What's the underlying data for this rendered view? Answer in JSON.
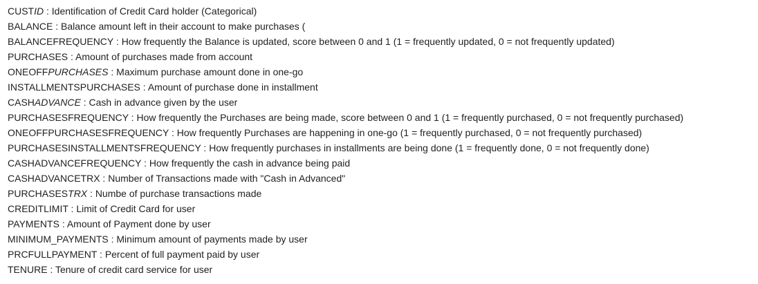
{
  "items": [
    {
      "term_plain": "CUST",
      "term_italic": "ID",
      "sep": " : ",
      "desc": "Identification of Credit Card holder (Categorical)"
    },
    {
      "term_plain": "BALANCE",
      "term_italic": "",
      "sep": " : ",
      "desc": "Balance amount left in their account to make purchases ("
    },
    {
      "term_plain": "BALANCEFREQUENCY",
      "term_italic": "",
      "sep": " : ",
      "desc": "How frequently the Balance is updated, score between 0 and 1 (1 = frequently updated, 0 = not frequently updated)"
    },
    {
      "term_plain": "PURCHASES",
      "term_italic": "",
      "sep": " : ",
      "desc": "Amount of purchases made from account"
    },
    {
      "term_plain": "ONEOFF",
      "term_italic": "PURCHASES",
      "sep": " : ",
      "desc": "Maximum purchase amount done in one-go"
    },
    {
      "term_plain": "INSTALLMENTSPURCHASES",
      "term_italic": "",
      "sep": " : ",
      "desc": "Amount of purchase done in installment"
    },
    {
      "term_plain": "CASH",
      "term_italic": "ADVANCE",
      "sep": " : ",
      "desc": "Cash in advance given by the user"
    },
    {
      "term_plain": "PURCHASESFREQUENCY",
      "term_italic": "",
      "sep": " : ",
      "desc": "How frequently the Purchases are being made, score between 0 and 1 (1 = frequently purchased, 0 = not frequently purchased)"
    },
    {
      "term_plain": "ONEOFFPURCHASESFREQUENCY",
      "term_italic": "",
      "sep": " : ",
      "desc": "How frequently Purchases are happening in one-go (1 = frequently purchased, 0 = not frequently purchased)"
    },
    {
      "term_plain": "PURCHASESINSTALLMENTSFREQUENCY",
      "term_italic": "",
      "sep": " : ",
      "desc": "How frequently purchases in installments are being done (1 = frequently done, 0 = not frequently done)"
    },
    {
      "term_plain": "CASHADVANCEFREQUENCY",
      "term_italic": "",
      "sep": " : ",
      "desc": "How frequently the cash in advance being paid"
    },
    {
      "term_plain": "CASHADVANCETRX",
      "term_italic": "",
      "sep": " : ",
      "desc": "Number of Transactions made with \"Cash in Advanced\""
    },
    {
      "term_plain": "PURCHASES",
      "term_italic": "TRX",
      "sep": " : ",
      "desc": "Numbe of purchase transactions made"
    },
    {
      "term_plain": "CREDITLIMIT",
      "term_italic": "",
      "sep": " : ",
      "desc": "Limit of Credit Card for user"
    },
    {
      "term_plain": "PAYMENTS",
      "term_italic": "",
      "sep": " : ",
      "desc": "Amount of Payment done by user"
    },
    {
      "term_plain": "MINIMUM_PAYMENTS",
      "term_italic": "",
      "sep": " : ",
      "desc": "Minimum amount of payments made by user"
    },
    {
      "term_plain": "PRCFULLPAYMENT",
      "term_italic": "",
      "sep": " : ",
      "desc": "Percent of full payment paid by user"
    },
    {
      "term_plain": "TENURE",
      "term_italic": "",
      "sep": " : ",
      "desc": "Tenure of credit card service for user"
    }
  ]
}
